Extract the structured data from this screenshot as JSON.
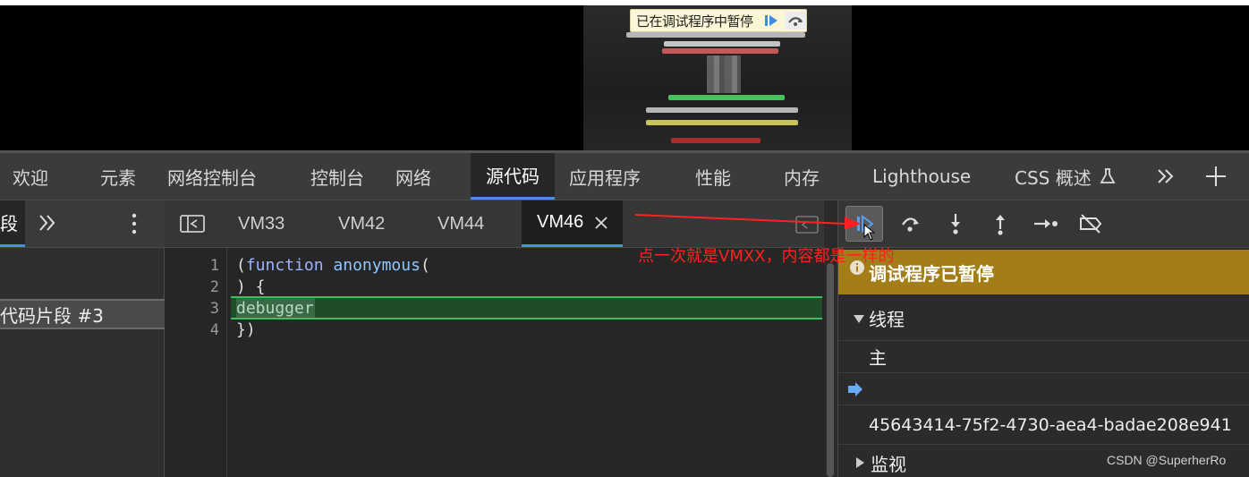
{
  "page_overlay": {
    "paused_text": "已在调试程序中暂停",
    "icons": [
      "resume-icon",
      "step-over-icon"
    ]
  },
  "main_tabs": [
    {
      "label": "欢迎"
    },
    {
      "label": "元素"
    },
    {
      "label": "网络控制台"
    },
    {
      "label": "控制台"
    },
    {
      "label": "网络"
    },
    {
      "label": "源代码",
      "active": true
    },
    {
      "label": "应用程序"
    },
    {
      "label": "性能"
    },
    {
      "label": "内存"
    },
    {
      "label": "Lighthouse"
    },
    {
      "label": "CSS 概述"
    }
  ],
  "left_pane": {
    "active_tab_fragment": "段",
    "snippet_item": "代码片段 #3"
  },
  "editor": {
    "tabs": [
      "VM33",
      "VM42",
      "VM44",
      "VM46"
    ],
    "active_tab": "VM46",
    "line_numbers": [
      "1",
      "2",
      "3",
      "4"
    ],
    "lines": {
      "l1_punct": "(",
      "l1_kw": "function",
      "l1_fn": "anonymous",
      "l1_end": "(",
      "l2": ") {",
      "l3": "debugger",
      "l4": "})"
    },
    "paused_line": 3
  },
  "sidebar": {
    "toolbar_icons": [
      "resume-icon",
      "step-over-icon",
      "step-into-icon",
      "step-out-icon",
      "step-icon",
      "deactivate-breakpoints-icon"
    ],
    "paused_banner": "调试程序已暂停",
    "threads_header": "线程",
    "thread_main": "主",
    "thread_id": "45643414-75f2-4730-aea4-badae208e941",
    "watch_header": "监视"
  },
  "annotation": {
    "text": "点一次就是VMXX，内容都是一样的"
  },
  "watermark": "CSDN @SuperherRo",
  "colors": {
    "active_tab_underline": "#4a90e2",
    "paused_banner": "#a37e18",
    "paused_line": "#1f4d2a",
    "annotation_red": "#ff2020"
  }
}
